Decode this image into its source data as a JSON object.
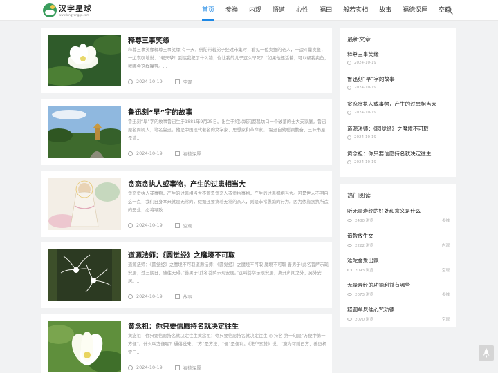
{
  "header": {
    "logo_title": "汉字星球",
    "logo_sub": "www.longyongge.com",
    "nav": [
      "首页",
      "参禅",
      "内观",
      "悟道",
      "心性",
      "福田",
      "般若实相",
      "故事",
      "福德深厚",
      "空观"
    ],
    "active_index": 0
  },
  "posts": [
    {
      "title": "释尊三事笑缘",
      "excerpt": "释尊三事笑缘释尊三事笑缘 有一天，佛陀带着弟子经过市集时，看见一位卖鱼的老人，一边斗量卖鱼，一边哀叹地说：“老天爷！到底我犯了什么错，你让我的儿子这么早死？”如果他还活着，可以帮我卖鱼，我哪会这样操劳。...",
      "date": "2024-10-19",
      "category": "空观",
      "thumb": "lotus-white"
    },
    {
      "title": "鲁迅刻“早”字的故事",
      "excerpt": "鲁迅刻“早”字的故事鲁迅生于1881年9月25日。出生于绍兴城内都昌坊口一个破落的士大夫家庭。鲁迅原名周树人，笔名鲁迅。他是中国现代著名的文学家、思想家和革命家。     鲁迅自幼聪颖勤奋，三味书屋是清...",
      "date": "2024-10-19",
      "category": "福德深厚",
      "thumb": "pagoda"
    },
    {
      "title": "贪恋贪执人或事物，产生的过患相当大",
      "excerpt": "贪恋贪执人或事物，产生的过患相当大不管是贪恋人或贪执事物，产生的过患都相当大。可是世人不明白这一点，我们自身本来就是无常的，假如还要贪着无常的亲人，则是非常愚痴的行为。因为依靠贪执所造的恶业，必将导致...",
      "date": "2024-10-19",
      "category": "空观",
      "thumb": "guanyin"
    },
    {
      "title": "道源法师：《圆觉经》之魔境不可取",
      "excerpt": "道源法师：《圆觉经》之魔境不可取道源法师：《圆觉经》之魔境不可取 魔境不可取 善男子!此名菩萨示现安居，过三期日，随往无碍。”善男子!此名菩萨示现安居。”这叫菩萨示现安居，离开声闻之外，另外安居。...",
      "date": "2024-10-19",
      "category": "故事",
      "thumb": "spider-lily"
    },
    {
      "title": "黄念祖：你只要信愿持名就决定往生",
      "excerpt": "黄念祖：你只要信愿持名就决定往生黄念祖：你只要信愿持名就决定往生 ◎ 持名 第一句是“方便中第一方便”。什么叫方便呢？通俗说来，“方”是方法，“便”是便利。《法华玄赞》说：“施为可则曰方，善逗机宜曰...",
      "date": "2024-10-19",
      "category": "福德深厚",
      "thumb": "lotus-green"
    }
  ],
  "sidebar": {
    "recent": {
      "title": "最新文章",
      "items": [
        {
          "title": "释尊三事笑缘",
          "date": "2024-10-19"
        },
        {
          "title": "鲁迅刻“早”字的故事",
          "date": "2024-10-19"
        },
        {
          "title": "贪恋贪执人或事物，产生的过患相当大",
          "date": "2024-10-19"
        },
        {
          "title": "道源法师：《圆觉经》之魔境不可取",
          "date": "2024-10-19"
        },
        {
          "title": "黄念祖：你只要信愿持名就决定往生",
          "date": "2024-10-19"
        }
      ]
    },
    "hot": {
      "title": "热门阅读",
      "items": [
        {
          "title": "听无量寿经的好处和意义是什么",
          "views": "2480 浏览",
          "category": "参禅"
        },
        {
          "title": "谙教放生文",
          "views": "2222 浏览",
          "category": "内观"
        },
        {
          "title": "难陀舍爱出家",
          "views": "2093 浏览",
          "category": "空观"
        },
        {
          "title": "无量寿经的功德利益有哪些",
          "views": "2073 浏览",
          "category": "参禅"
        },
        {
          "title": "释迦牟尼佛心咒功德",
          "views": "2070 浏览",
          "category": "空观"
        }
      ]
    }
  },
  "colors": {
    "accent": "#1e88e5",
    "background": "#f1f2f3"
  },
  "icons": {
    "search": "search-icon",
    "clock": "clock-icon",
    "folder": "folder-icon",
    "eye": "eye-icon",
    "back_to_top": "rocket-icon"
  }
}
